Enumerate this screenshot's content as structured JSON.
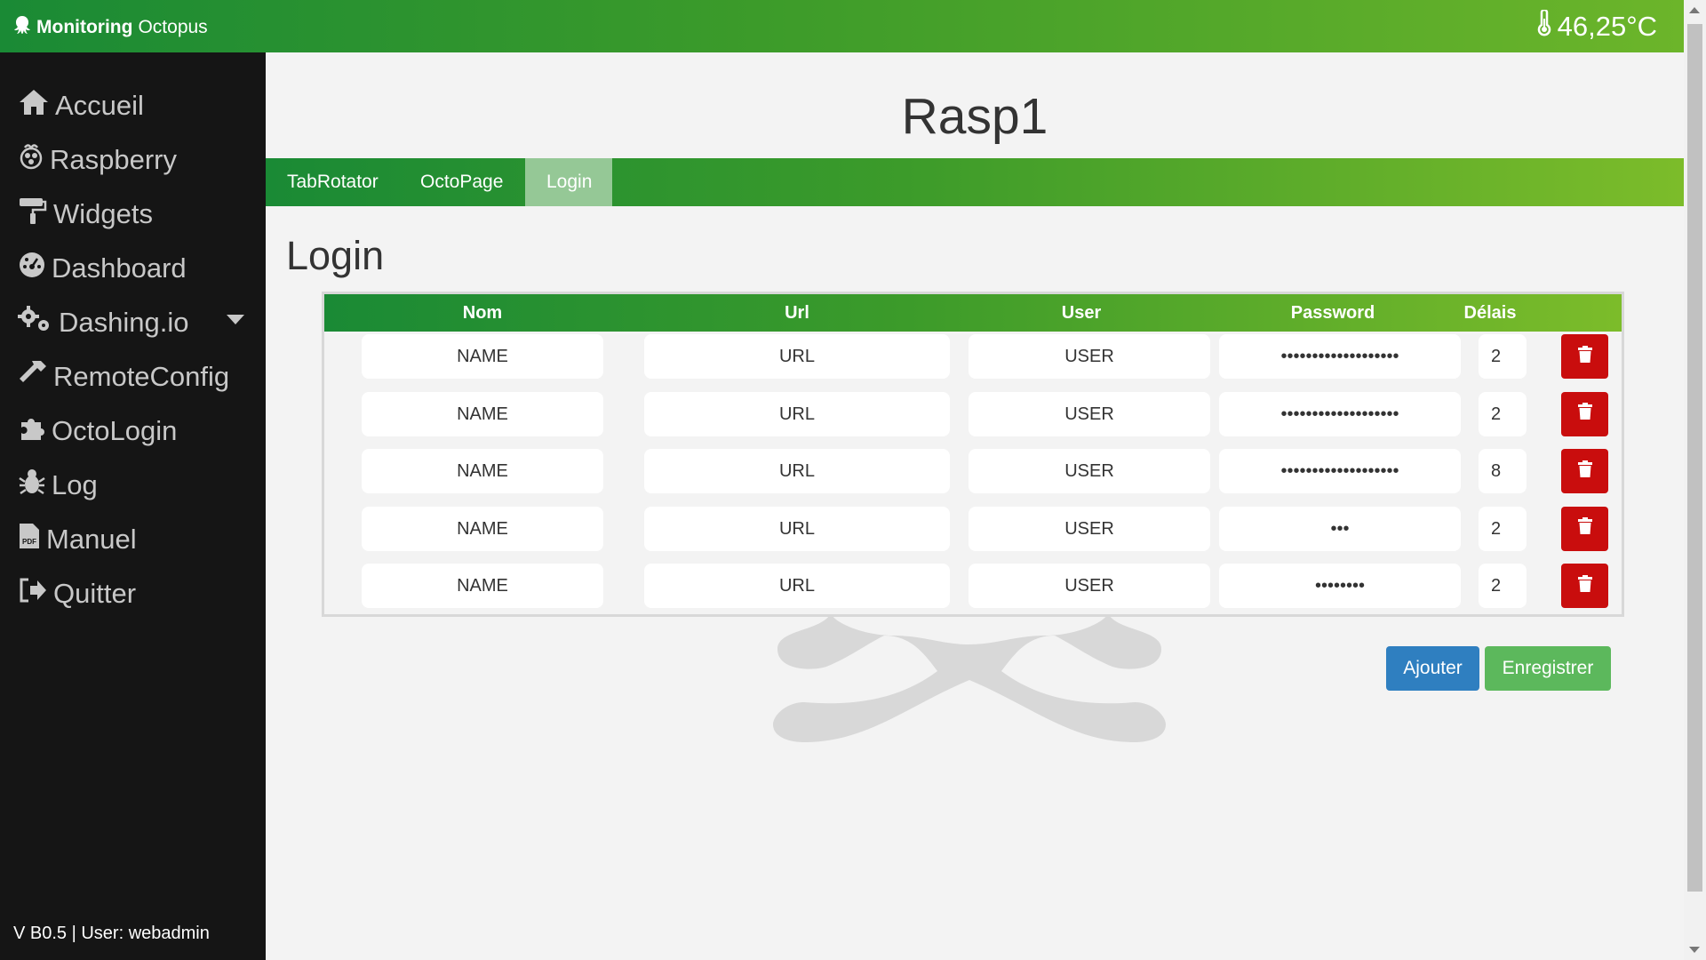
{
  "header": {
    "brand_bold": "Monitoring",
    "brand_rest": "Octopus",
    "temperature": "46,25°C"
  },
  "sidebar": {
    "items": [
      {
        "label": "Accueil",
        "icon": "home-icon"
      },
      {
        "label": "Raspberry",
        "icon": "raspberry-icon"
      },
      {
        "label": "Widgets",
        "icon": "paint-roller-icon"
      },
      {
        "label": "Dashboard",
        "icon": "dashboard-gauge-icon"
      },
      {
        "label": "Dashing.io",
        "icon": "cogs-icon"
      },
      {
        "label": "RemoteConfig",
        "icon": "hammer-icon"
      },
      {
        "label": "OctoLogin",
        "icon": "puzzle-icon"
      },
      {
        "label": "Log",
        "icon": "bug-icon"
      },
      {
        "label": "Manuel",
        "icon": "pdf-file-icon"
      },
      {
        "label": "Quitter",
        "icon": "sign-out-icon"
      }
    ],
    "footer": "V B0.5 | User: webadmin"
  },
  "main": {
    "title": "Rasp1",
    "tabs": [
      {
        "label": "TabRotator"
      },
      {
        "label": "OctoPage"
      },
      {
        "label": "Login"
      }
    ],
    "active_tab": "Login",
    "section_title": "Login"
  },
  "table": {
    "headers": [
      "Nom",
      "Url",
      "User",
      "Password",
      "Délais"
    ],
    "rows": [
      {
        "name": "NAME",
        "url": "URL",
        "user": "USER",
        "password": "•••••••••••••••••••",
        "delay": "2"
      },
      {
        "name": "NAME",
        "url": "URL",
        "user": "USER",
        "password": "•••••••••••••••••••",
        "delay": "2"
      },
      {
        "name": "NAME",
        "url": "URL",
        "user": "USER",
        "password": "•••••••••••••••••••",
        "delay": "8"
      },
      {
        "name": "NAME",
        "url": "URL",
        "user": "USER",
        "password": "•••",
        "delay": "2"
      },
      {
        "name": "NAME",
        "url": "URL",
        "user": "USER",
        "password": "••••••••",
        "delay": "2"
      }
    ]
  },
  "actions": {
    "add_label": "Ajouter",
    "save_label": "Enregistrer"
  },
  "colors": {
    "green_dark": "#1a8a35",
    "green_light": "#7cbc2a",
    "active_tab": "#95c896",
    "danger": "#c90d0d",
    "primary": "#2f7fc0",
    "success": "#5cb85c",
    "sidebar_bg": "#151515"
  }
}
